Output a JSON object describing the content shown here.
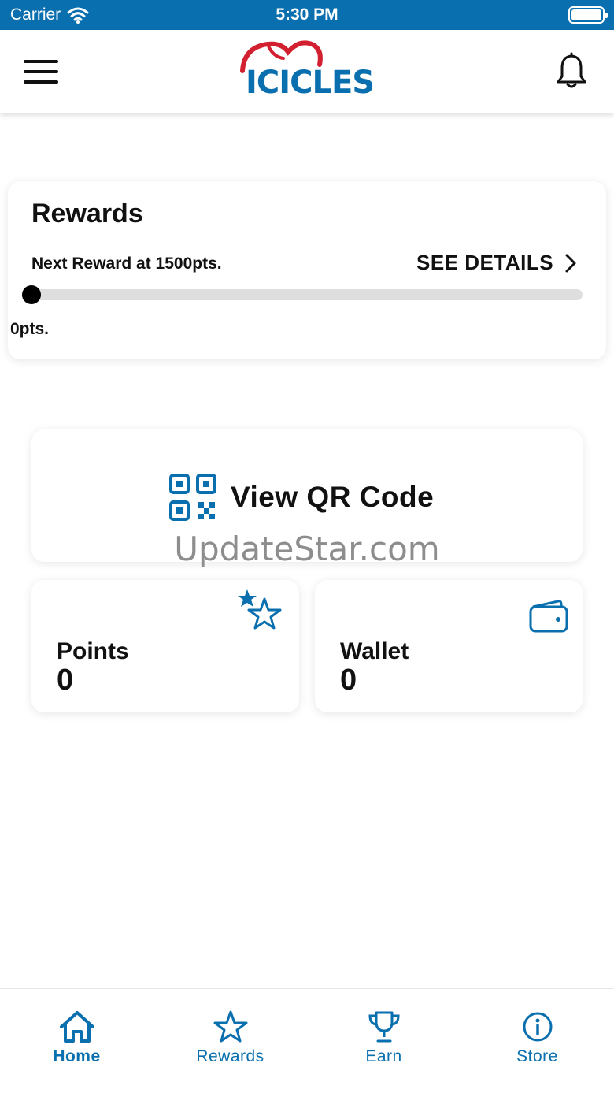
{
  "status_bar": {
    "carrier": "Carrier",
    "time": "5:30 PM"
  },
  "header": {
    "logo_text": "ICICLES"
  },
  "rewards": {
    "title": "Rewards",
    "next_reward": "Next Reward at 1500pts.",
    "see_details": "SEE DETAILS",
    "progress": 0,
    "current_points": "0pts."
  },
  "qr": {
    "label": "View QR Code"
  },
  "watermark": "UpdateStar.com",
  "points": {
    "label": "Points",
    "value": "0"
  },
  "wallet": {
    "label": "Wallet",
    "value": "0"
  },
  "nav": {
    "items": [
      {
        "label": "Home"
      },
      {
        "label": "Rewards"
      },
      {
        "label": "Earn"
      },
      {
        "label": "Store"
      }
    ]
  },
  "colors": {
    "brand_blue": "#0a6fae",
    "logo_red": "#d32030",
    "track": "#dedede"
  }
}
